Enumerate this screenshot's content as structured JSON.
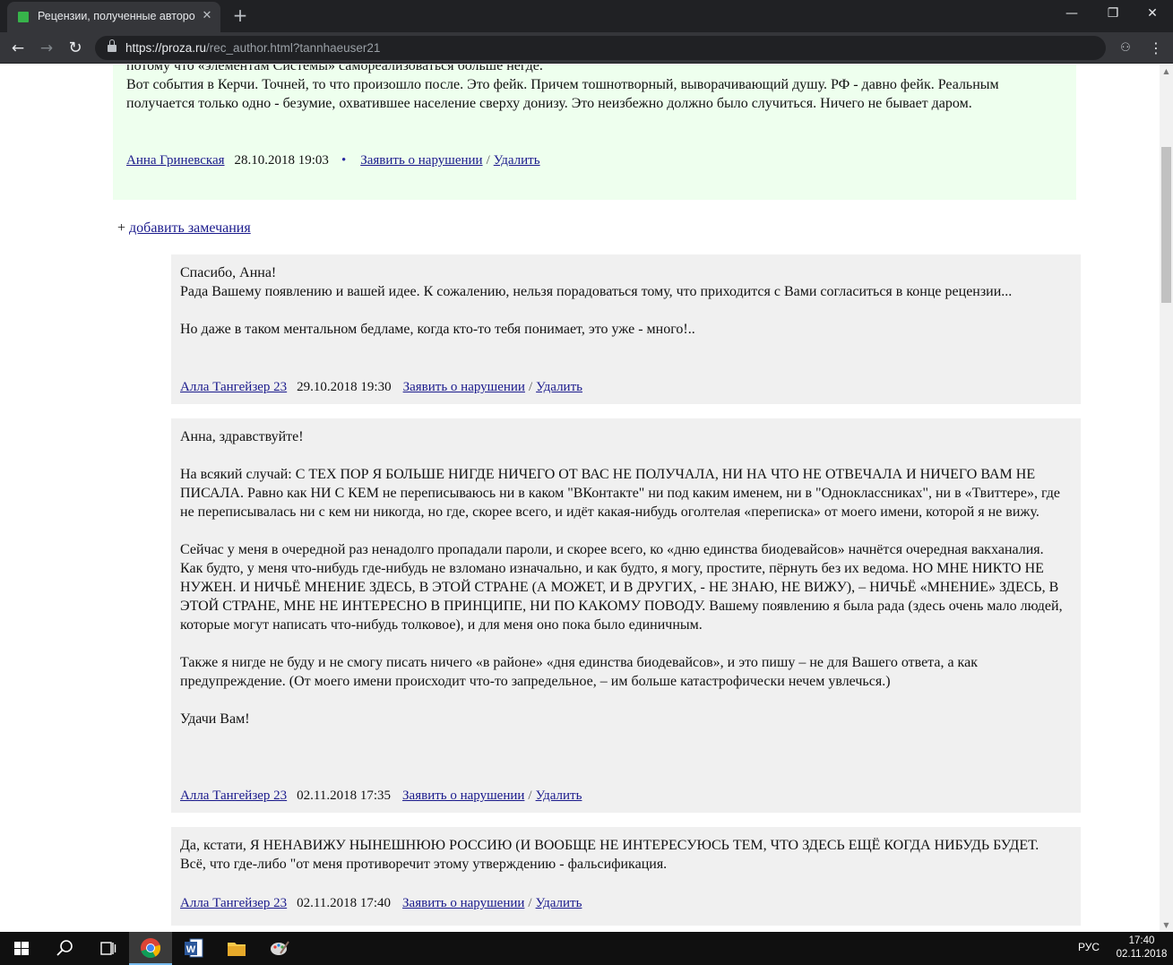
{
  "browser": {
    "tab_title": "Рецензии, полученные автором",
    "tab_close": "✕",
    "new_tab": "+",
    "url_host": "https://proza.ru",
    "url_path": "/rec_author.html?tannhaeuser21",
    "win_min": "—",
    "win_max": "❐",
    "win_close": "✕",
    "back": "←",
    "forward": "→",
    "reload": "↻",
    "menu": "⋮",
    "ext": "⚇"
  },
  "review": {
    "cut_line": "потому что «элементам Системы» самореализоваться больше негде.",
    "text": "Вот события в Керчи. Точней, то что произошло после. Это фейк. Причем тошнотворный, выворачивающий душу. РФ - давно фейк. Реальным получается только одно - безумие, охватившее население сверху донизу. Это неизбежно должно было случиться. Ничего не бывает даром.",
    "author": "Анна Гриневская",
    "date": "28.10.2018 19:03",
    "dot": "•",
    "report": "Заявить о нарушении",
    "slash": "/",
    "delete": "Удалить"
  },
  "add_notes": {
    "plus": "+ ",
    "label": "добавить замечания"
  },
  "answers": [
    {
      "paragraphs": [
        "Спасибо, Анна!\nРада Вашему появлению и вашей идее. К сожалению, нельзя порадоваться тому, что приходится с Вами согласиться в конце рецензии...",
        "Но даже в таком ментальном бедламе, когда кто-то тебя понимает, это уже - много!.."
      ],
      "author": "Алла Тангейзер 23",
      "date": "29.10.2018 19:30",
      "report": "Заявить о нарушении",
      "delete": "Удалить"
    },
    {
      "paragraphs": [
        "Анна, здравствуйте!",
        "На всякий случай: С ТЕХ ПОР Я БОЛЬШЕ НИГДЕ НИЧЕГО ОТ ВАС НЕ ПОЛУЧАЛА, НИ НА ЧТО НЕ ОТВЕЧАЛА И НИЧЕГО ВАМ НЕ ПИСАЛА. Равно как НИ С КЕМ не переписываюсь ни в каком \"ВКонтакте\" ни под каким именем, ни в \"Одноклассниках\", ни в «Твиттере», где не переписывалась ни с кем ни никогда, но где, скорее всего, и идёт какая-нибудь оголтелая «переписка» от моего имени, которой я не вижу.",
        "Сейчас у меня в очередной раз ненадолго пропадали пароли, и скорее всего, ко «дню единства биодевайсов» начнётся очередная вакханалия. Как будто, у меня что-нибудь где-нибудь не взломано изначально, и как будто, я могу, простите, пёрнуть без их ведома. НО МНЕ НИКТО НЕ НУЖЕН. И НИЧЬЁ МНЕНИЕ ЗДЕСЬ, В ЭТОЙ СТРАНЕ (А МОЖЕТ, И В ДРУГИХ, - НЕ ЗНАЮ, НЕ ВИЖУ), – НИЧЬЁ «МНЕНИЕ» ЗДЕСЬ, В ЭТОЙ СТРАНЕ, МНЕ НЕ ИНТЕРЕСНО В ПРИНЦИПЕ, НИ ПО КАКОМУ ПОВОДУ. Вашему появлению я была рада (здесь очень мало людей, которые могут написать что-нибудь толковое), и для меня оно пока было единичным.",
        "Также я нигде не буду и не смогу писать ничего «в районе» «дня единства биодевайсов», и это пишу – не для Вашего ответа, а как предупреждение. (От моего имени происходит что-то запредельное, – им больше катастрофически нечем увлечься.)",
        "Удачи Вам!"
      ],
      "author": "Алла Тангейзер 23",
      "date": "02.11.2018 17:35",
      "report": "Заявить о нарушении",
      "delete": "Удалить"
    },
    {
      "paragraphs": [
        "Да, кстати, Я НЕНАВИЖУ НЫНЕШНЮЮ РОССИЮ (И ВООБЩЕ НЕ ИНТЕРЕСУЮСЬ ТЕМ, ЧТО ЗДЕСЬ ЕЩЁ КОГДА НИБУДЬ БУДЕТ. Всё, что где-либо \"от меня противоречит этому утверждению - фальсификация."
      ],
      "author": "Алла Тангейзер 23",
      "date": "02.11.2018 17:40",
      "report": "Заявить о нарушении",
      "delete": "Удалить"
    }
  ],
  "taskbar": {
    "lang": "РУС",
    "time": "17:40",
    "date": "02.11.2018"
  },
  "colors": {
    "review_bg": "#eeffee",
    "answer_bg": "#f0f0f0",
    "link": "#1a1a8c"
  }
}
